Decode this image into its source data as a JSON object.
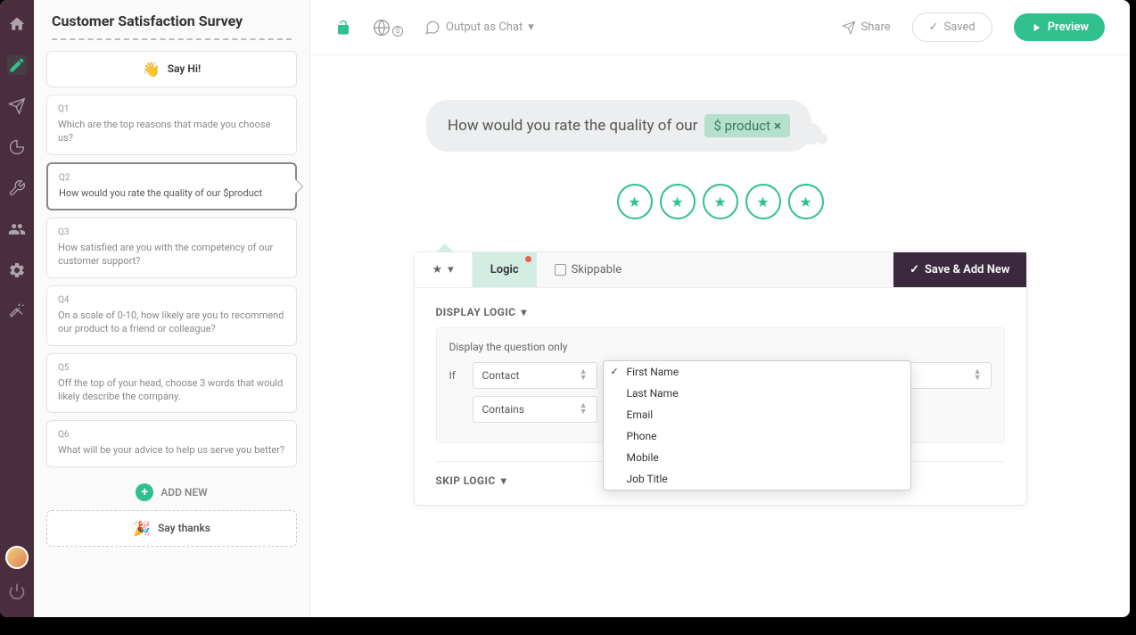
{
  "survey": {
    "title": "Customer Satisfaction Survey"
  },
  "sidebar": {
    "say_hi": "Say Hi!",
    "questions": [
      {
        "num": "Q1",
        "text": "Which are the top reasons that made you choose us?"
      },
      {
        "num": "Q2",
        "text": "How would you rate the quality of our $product"
      },
      {
        "num": "Q3",
        "text": "How satisfied are you with the competency of our customer support?"
      },
      {
        "num": "Q4",
        "text": "On a scale of 0-10, how likely are you to recommend our product to a friend or colleague?"
      },
      {
        "num": "Q5",
        "text": "Off the top of your head, choose 3 words that would likely describe the company."
      },
      {
        "num": "Q6",
        "text": "What will be your advice to help us serve you better?"
      }
    ],
    "add_new": "ADD NEW",
    "say_thanks": "Say thanks"
  },
  "topbar": {
    "output": "Output as Chat",
    "share": "Share",
    "saved": "Saved",
    "preview": "Preview"
  },
  "question": {
    "text": "How would you rate the quality of our",
    "variable": "$ product"
  },
  "editor": {
    "tabs": {
      "logic": "Logic",
      "skippable": "Skippable",
      "save": "Save & Add New"
    },
    "display_logic": {
      "title": "DISPLAY LOGIC",
      "helper": "Display the question only",
      "if": "If",
      "field1": "Contact",
      "field2": "Contains",
      "dropdown": [
        "First Name",
        "Last Name",
        "Email",
        "Phone",
        "Mobile",
        "Job Title"
      ],
      "selected": "First Name"
    },
    "skip_logic": {
      "title": "SKIP LOGIC"
    }
  }
}
